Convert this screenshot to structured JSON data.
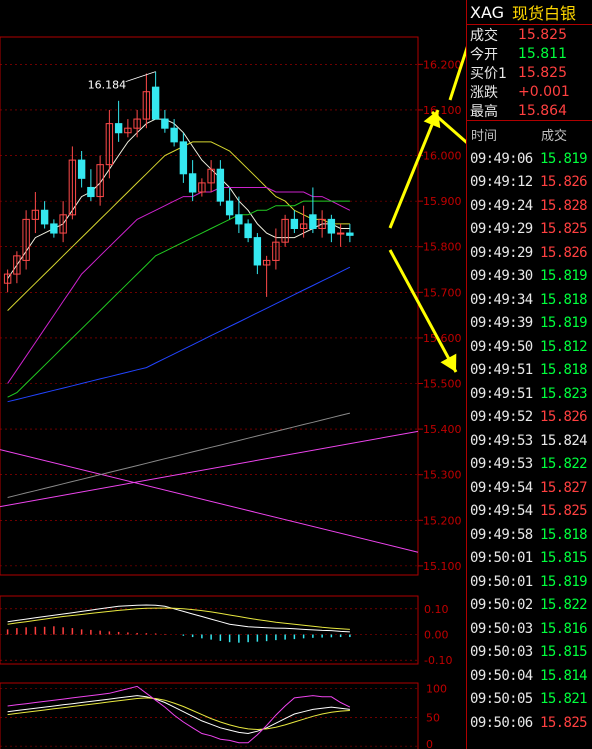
{
  "header": {
    "symbol": "XAG",
    "name": "现货白银"
  },
  "quote": [
    {
      "label": "成交",
      "value": "15.825",
      "dir": "up"
    },
    {
      "label": "今开",
      "value": "15.811",
      "dir": "dn"
    },
    {
      "label": "买价1",
      "value": "15.825",
      "dir": "up"
    },
    {
      "label": "涨跌",
      "value": "+0.001",
      "dir": "up"
    },
    {
      "label": "最高",
      "value": "15.864",
      "dir": "up"
    }
  ],
  "trades_header": {
    "time": "时间",
    "price": "成交"
  },
  "trades": [
    {
      "time": "09:49:06",
      "price": "15.819",
      "dir": "dn"
    },
    {
      "time": "09:49:12",
      "price": "15.826",
      "dir": "up"
    },
    {
      "time": "09:49:24",
      "price": "15.828",
      "dir": "up"
    },
    {
      "time": "09:49:29",
      "price": "15.825",
      "dir": "up"
    },
    {
      "time": "09:49:29",
      "price": "15.826",
      "dir": "up"
    },
    {
      "time": "09:49:30",
      "price": "15.819",
      "dir": "dn"
    },
    {
      "time": "09:49:34",
      "price": "15.818",
      "dir": "dn"
    },
    {
      "time": "09:49:39",
      "price": "15.819",
      "dir": "dn"
    },
    {
      "time": "09:49:50",
      "price": "15.812",
      "dir": "dn"
    },
    {
      "time": "09:49:51",
      "price": "15.818",
      "dir": "dn"
    },
    {
      "time": "09:49:51",
      "price": "15.823",
      "dir": "dn"
    },
    {
      "time": "09:49:52",
      "price": "15.826",
      "dir": "up"
    },
    {
      "time": "09:49:53",
      "price": "15.824",
      "dir": "eq"
    },
    {
      "time": "09:49:53",
      "price": "15.822",
      "dir": "dn"
    },
    {
      "time": "09:49:54",
      "price": "15.827",
      "dir": "up"
    },
    {
      "time": "09:49:54",
      "price": "15.825",
      "dir": "up"
    },
    {
      "time": "09:49:58",
      "price": "15.818",
      "dir": "dn"
    },
    {
      "time": "09:50:01",
      "price": "15.815",
      "dir": "dn"
    },
    {
      "time": "09:50:01",
      "price": "15.819",
      "dir": "dn"
    },
    {
      "time": "09:50:02",
      "price": "15.822",
      "dir": "dn"
    },
    {
      "time": "09:50:03",
      "price": "15.816",
      "dir": "dn"
    },
    {
      "time": "09:50:03",
      "price": "15.815",
      "dir": "dn"
    },
    {
      "time": "09:50:04",
      "price": "15.814",
      "dir": "dn"
    },
    {
      "time": "09:50:05",
      "price": "15.821",
      "dir": "dn"
    },
    {
      "time": "09:50:06",
      "price": "15.825",
      "dir": "up"
    }
  ],
  "colors": {
    "up": "#ff4040",
    "down": "#00ff3c",
    "grid": "#b00000",
    "axis_text": "#c00000"
  },
  "chart_data": [
    {
      "type": "candlestick",
      "y_ticks": [
        "16.200",
        "16.100",
        "16.000",
        "15.900",
        "15.800",
        "15.700",
        "15.600",
        "15.500",
        "15.400",
        "15.300",
        "15.200",
        "15.100"
      ],
      "ylim": [
        15.08,
        16.26
      ],
      "annotation": "16.184",
      "grid": true,
      "candles": [
        {
          "o": 15.72,
          "h": 15.75,
          "l": 15.7,
          "c": 15.74
        },
        {
          "o": 15.74,
          "h": 15.79,
          "l": 15.72,
          "c": 15.78
        },
        {
          "o": 15.77,
          "h": 15.88,
          "l": 15.75,
          "c": 15.86
        },
        {
          "o": 15.86,
          "h": 15.92,
          "l": 15.83,
          "c": 15.88
        },
        {
          "o": 15.88,
          "h": 15.9,
          "l": 15.84,
          "c": 15.85
        },
        {
          "o": 15.85,
          "h": 15.86,
          "l": 15.82,
          "c": 15.83
        },
        {
          "o": 15.83,
          "h": 15.9,
          "l": 15.81,
          "c": 15.87
        },
        {
          "o": 15.87,
          "h": 16.02,
          "l": 15.86,
          "c": 15.99
        },
        {
          "o": 15.99,
          "h": 16.01,
          "l": 15.93,
          "c": 15.95
        },
        {
          "o": 15.93,
          "h": 15.97,
          "l": 15.9,
          "c": 15.91
        },
        {
          "o": 15.91,
          "h": 16.0,
          "l": 15.89,
          "c": 15.98
        },
        {
          "o": 15.98,
          "h": 16.1,
          "l": 15.95,
          "c": 16.07
        },
        {
          "o": 16.07,
          "h": 16.12,
          "l": 16.03,
          "c": 16.05
        },
        {
          "o": 16.05,
          "h": 16.08,
          "l": 16.04,
          "c": 16.06
        },
        {
          "o": 16.06,
          "h": 16.1,
          "l": 16.04,
          "c": 16.08
        },
        {
          "o": 16.08,
          "h": 16.18,
          "l": 16.06,
          "c": 16.14
        },
        {
          "o": 16.15,
          "h": 16.184,
          "l": 16.08,
          "c": 16.08
        },
        {
          "o": 16.08,
          "h": 16.1,
          "l": 16.05,
          "c": 16.06
        },
        {
          "o": 16.06,
          "h": 16.08,
          "l": 16.02,
          "c": 16.03
        },
        {
          "o": 16.03,
          "h": 16.05,
          "l": 15.94,
          "c": 15.96
        },
        {
          "o": 15.96,
          "h": 15.99,
          "l": 15.9,
          "c": 15.92
        },
        {
          "o": 15.92,
          "h": 15.95,
          "l": 15.91,
          "c": 15.94
        },
        {
          "o": 15.94,
          "h": 15.99,
          "l": 15.92,
          "c": 15.97
        },
        {
          "o": 15.97,
          "h": 15.99,
          "l": 15.89,
          "c": 15.9
        },
        {
          "o": 15.9,
          "h": 15.93,
          "l": 15.86,
          "c": 15.87
        },
        {
          "o": 15.87,
          "h": 15.91,
          "l": 15.83,
          "c": 15.85
        },
        {
          "o": 15.85,
          "h": 15.86,
          "l": 15.81,
          "c": 15.82
        },
        {
          "o": 15.82,
          "h": 15.83,
          "l": 15.74,
          "c": 15.76
        },
        {
          "o": 15.76,
          "h": 15.78,
          "l": 15.69,
          "c": 15.77
        },
        {
          "o": 15.77,
          "h": 15.84,
          "l": 15.75,
          "c": 15.81
        },
        {
          "o": 15.81,
          "h": 15.87,
          "l": 15.8,
          "c": 15.86
        },
        {
          "o": 15.86,
          "h": 15.88,
          "l": 15.83,
          "c": 15.84
        },
        {
          "o": 15.84,
          "h": 15.89,
          "l": 15.82,
          "c": 15.85
        },
        {
          "o": 15.87,
          "h": 15.93,
          "l": 15.83,
          "c": 15.84
        },
        {
          "o": 15.84,
          "h": 15.88,
          "l": 15.82,
          "c": 15.86
        },
        {
          "o": 15.86,
          "h": 15.87,
          "l": 15.81,
          "c": 15.83
        },
        {
          "o": 15.83,
          "h": 15.85,
          "l": 15.8,
          "c": 15.83
        },
        {
          "o": 15.83,
          "h": 15.85,
          "l": 15.81,
          "c": 15.825
        }
      ],
      "moving_averages": [
        {
          "color": "#f0f0e0",
          "values": [
            15.73,
            15.76,
            15.79,
            15.82,
            15.83,
            15.84,
            15.85,
            15.88,
            15.91,
            15.92,
            15.94,
            15.97,
            16.0,
            16.03,
            16.05,
            16.07,
            16.08,
            16.08,
            16.07,
            16.05,
            16.02,
            15.99,
            15.97,
            15.95,
            15.93,
            15.9,
            15.88,
            15.85,
            15.83,
            15.82,
            15.82,
            15.82,
            15.83,
            15.84,
            15.85,
            15.85,
            15.84,
            15.84
          ]
        },
        {
          "color": "#d6d630",
          "values": [
            15.66,
            15.68,
            15.7,
            15.72,
            15.74,
            15.76,
            15.78,
            15.8,
            15.82,
            15.84,
            15.86,
            15.88,
            15.9,
            15.92,
            15.94,
            15.96,
            15.98,
            16.0,
            16.01,
            16.02,
            16.03,
            16.03,
            16.03,
            16.02,
            16.01,
            15.99,
            15.97,
            15.95,
            15.93,
            15.91,
            15.9,
            15.88,
            15.87,
            15.86,
            15.86,
            15.85,
            15.85,
            15.85
          ]
        },
        {
          "color": "#cc22cc",
          "values": [
            15.5,
            15.53,
            15.56,
            15.59,
            15.62,
            15.65,
            15.68,
            15.71,
            15.74,
            15.76,
            15.78,
            15.8,
            15.82,
            15.84,
            15.86,
            15.87,
            15.88,
            15.89,
            15.9,
            15.91,
            15.91,
            15.92,
            15.92,
            15.93,
            15.93,
            15.93,
            15.93,
            15.93,
            15.93,
            15.92,
            15.92,
            15.92,
            15.92,
            15.91,
            15.91,
            15.9,
            15.89,
            15.88
          ]
        },
        {
          "color": "#22cc22",
          "values": [
            15.47,
            15.48,
            15.5,
            15.52,
            15.54,
            15.56,
            15.58,
            15.6,
            15.62,
            15.64,
            15.66,
            15.68,
            15.7,
            15.72,
            15.74,
            15.76,
            15.78,
            15.79,
            15.8,
            15.81,
            15.82,
            15.83,
            15.84,
            15.85,
            15.86,
            15.87,
            15.87,
            15.88,
            15.88,
            15.89,
            15.89,
            15.89,
            15.9,
            15.9,
            15.9,
            15.9,
            15.9,
            15.9
          ]
        },
        {
          "color": "#2244ff",
          "values": [
            15.46,
            15.465,
            15.47,
            15.475,
            15.48,
            15.485,
            15.49,
            15.495,
            15.5,
            15.505,
            15.51,
            15.515,
            15.52,
            15.525,
            15.53,
            15.535,
            15.545,
            15.555,
            15.565,
            15.575,
            15.585,
            15.595,
            15.605,
            15.615,
            15.625,
            15.635,
            15.645,
            15.655,
            15.665,
            15.675,
            15.685,
            15.695,
            15.705,
            15.715,
            15.725,
            15.735,
            15.745,
            15.755
          ]
        },
        {
          "color": "#8a8a8a",
          "values": [
            15.25,
            15.255,
            15.26,
            15.265,
            15.27,
            15.275,
            15.28,
            15.285,
            15.29,
            15.295,
            15.3,
            15.305,
            15.31,
            15.315,
            15.32,
            15.325,
            15.33,
            15.335,
            15.34,
            15.345,
            15.35,
            15.355,
            15.36,
            15.365,
            15.37,
            15.375,
            15.38,
            15.385,
            15.39,
            15.395,
            15.4,
            15.405,
            15.41,
            15.415,
            15.42,
            15.425,
            15.43,
            15.435
          ]
        }
      ],
      "lines": [
        {
          "color": "#ee44ee",
          "from": 15.23,
          "to": 15.395
        },
        {
          "color": "#ee44ee",
          "from": 15.355,
          "to": 15.13
        }
      ]
    },
    {
      "type": "macd",
      "y_ticks": [
        "0.10",
        "0.00",
        "-0.10"
      ],
      "ylim": [
        -0.115,
        0.15
      ],
      "histogram": [
        0.02,
        0.025,
        0.028,
        0.03,
        0.03,
        0.032,
        0.028,
        0.025,
        0.02,
        0.018,
        0.015,
        0.012,
        0.01,
        0.008,
        0.006,
        0.005,
        0.004,
        0.002,
        0.0,
        -0.005,
        -0.01,
        -0.015,
        -0.02,
        -0.025,
        -0.03,
        -0.032,
        -0.03,
        -0.028,
        -0.026,
        -0.022,
        -0.02,
        -0.018,
        -0.015,
        -0.013,
        -0.012,
        -0.011,
        -0.01,
        -0.01
      ],
      "dif": [
        0.05,
        0.055,
        0.06,
        0.065,
        0.07,
        0.075,
        0.08,
        0.085,
        0.09,
        0.095,
        0.1,
        0.105,
        0.11,
        0.112,
        0.114,
        0.115,
        0.114,
        0.11,
        0.1,
        0.09,
        0.08,
        0.07,
        0.06,
        0.05,
        0.04,
        0.035,
        0.03,
        0.028,
        0.026,
        0.025,
        0.024,
        0.022,
        0.02,
        0.018,
        0.016,
        0.015,
        0.012,
        0.01
      ],
      "dea": [
        0.04,
        0.045,
        0.05,
        0.055,
        0.06,
        0.065,
        0.07,
        0.074,
        0.078,
        0.082,
        0.086,
        0.09,
        0.094,
        0.097,
        0.1,
        0.102,
        0.103,
        0.103,
        0.102,
        0.1,
        0.097,
        0.093,
        0.088,
        0.082,
        0.076,
        0.07,
        0.064,
        0.058,
        0.053,
        0.048,
        0.044,
        0.04,
        0.036,
        0.032,
        0.028,
        0.025,
        0.022,
        0.02
      ]
    },
    {
      "type": "kdj",
      "y_ticks": [
        "100",
        "50",
        "0"
      ],
      "ylim": [
        -5,
        110
      ],
      "k": [
        60,
        62,
        64,
        66,
        68,
        70,
        72,
        74,
        76,
        78,
        80,
        82,
        84,
        86,
        88,
        86,
        82,
        76,
        68,
        60,
        52,
        44,
        38,
        32,
        28,
        24,
        22,
        26,
        32,
        40,
        48,
        56,
        60,
        64,
        66,
        68,
        66,
        64
      ],
      "d": [
        55,
        57,
        59,
        61,
        63,
        65,
        67,
        69,
        71,
        73,
        75,
        77,
        79,
        81,
        83,
        84,
        83,
        80,
        75,
        69,
        62,
        55,
        48,
        42,
        37,
        33,
        30,
        29,
        30,
        33,
        37,
        42,
        47,
        52,
        56,
        59,
        61,
        62
      ],
      "j": [
        70,
        72,
        74,
        76,
        78,
        80,
        82,
        84,
        86,
        88,
        90,
        92,
        96,
        100,
        104,
        92,
        80,
        68,
        54,
        42,
        32,
        22,
        18,
        12,
        10,
        6,
        6,
        20,
        36,
        54,
        70,
        84,
        86,
        88,
        86,
        86,
        76,
        68
      ]
    }
  ]
}
